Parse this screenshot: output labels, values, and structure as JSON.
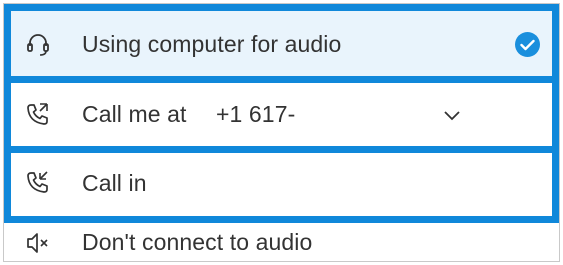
{
  "options": [
    {
      "label": "Using computer for audio",
      "icon": "headset-icon",
      "selected": true,
      "highlighted": true
    },
    {
      "label": "Call me at",
      "phone_value": "+1 617-",
      "icon": "phone-outgoing-icon",
      "dropdown_icon": "chevron-down-icon",
      "highlighted": true
    },
    {
      "label": "Call in",
      "icon": "phone-incoming-icon",
      "highlighted": true
    },
    {
      "label": "Don't connect to audio",
      "icon": "speaker-mute-icon",
      "highlighted": false
    }
  ],
  "colors": {
    "highlight_border": "#1088da",
    "selected_background": "#e9f4fc",
    "check_badge": "#1a8fdd",
    "text": "#333333"
  }
}
